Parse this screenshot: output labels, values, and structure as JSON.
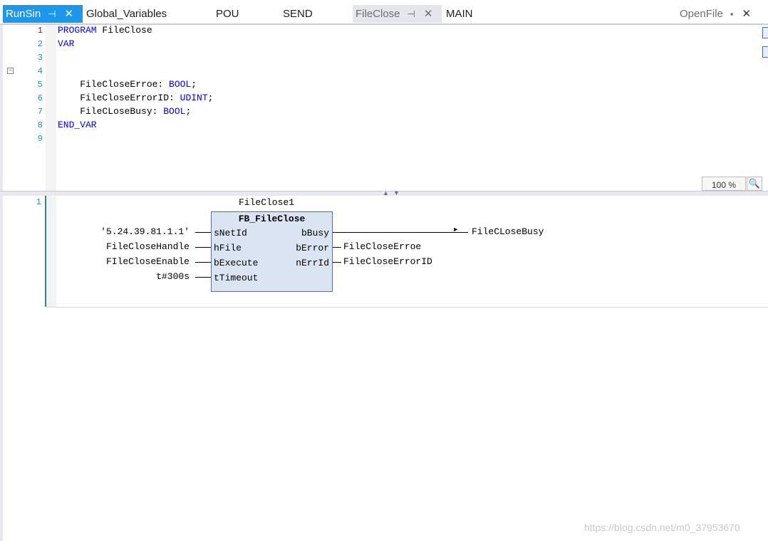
{
  "tabs": [
    {
      "label": "RunSin",
      "state": "active",
      "pin": "pin-icon",
      "close": "close-icon"
    },
    {
      "label": "Global_Variables"
    },
    {
      "label": "POU"
    },
    {
      "label": "SEND"
    },
    {
      "label": "FileClose",
      "state": "selected-inactive",
      "pin": "pin-icon",
      "close": "close-icon"
    },
    {
      "label": "MAIN"
    },
    {
      "label": "OpenFile",
      "pin": "pin-icon",
      "close": "close-icon"
    }
  ],
  "declaration": {
    "line_numbers": [
      "1",
      "2",
      "3",
      "4",
      "5",
      "6",
      "7",
      "8",
      "9"
    ],
    "lines": [
      {
        "kw": "PROGRAM",
        "rest": " FileClose"
      },
      {
        "kw": "VAR",
        "rest": ""
      },
      {
        "kw": "",
        "rest": ""
      },
      {
        "kw": "",
        "rest": ""
      },
      {
        "name": "    FileCloseErroe: ",
        "type": "BOOL",
        "end": ";"
      },
      {
        "name": "    FileCloseErrorID: ",
        "type": "UDINT",
        "end": ";"
      },
      {
        "name": "    FileCLoseBusy: ",
        "type": "BOOL",
        "end": ";"
      },
      {
        "kw": "END_VAR",
        "rest": ""
      },
      {
        "kw": "",
        "rest": ""
      }
    ],
    "zoom": "100 %"
  },
  "network": {
    "number": "1",
    "instance_name": "FileClose1",
    "block_type": "FB_FileClose",
    "inputs": [
      {
        "pin": "sNetId",
        "value": "'5.24.39.81.1.1'"
      },
      {
        "pin": "hFile",
        "value": "FileCloseHandle"
      },
      {
        "pin": "bExecute",
        "value": "FIleCloseEnable"
      },
      {
        "pin": "tTimeout",
        "value": "t#300s"
      }
    ],
    "outputs": [
      {
        "pin": "bBusy",
        "value": "FileCLoseBusy"
      },
      {
        "pin": "bError",
        "value": "FileCloseErroe"
      },
      {
        "pin": "nErrId",
        "value": "FileCloseErrorID"
      }
    ]
  },
  "watermark": "https://blog.csdn.net/m0_37953670",
  "colors": {
    "active_tab": "#1c97ea",
    "keyword": "#0000ff",
    "line_number": "#2b91af",
    "fb_fill": "#dbe4f3"
  }
}
